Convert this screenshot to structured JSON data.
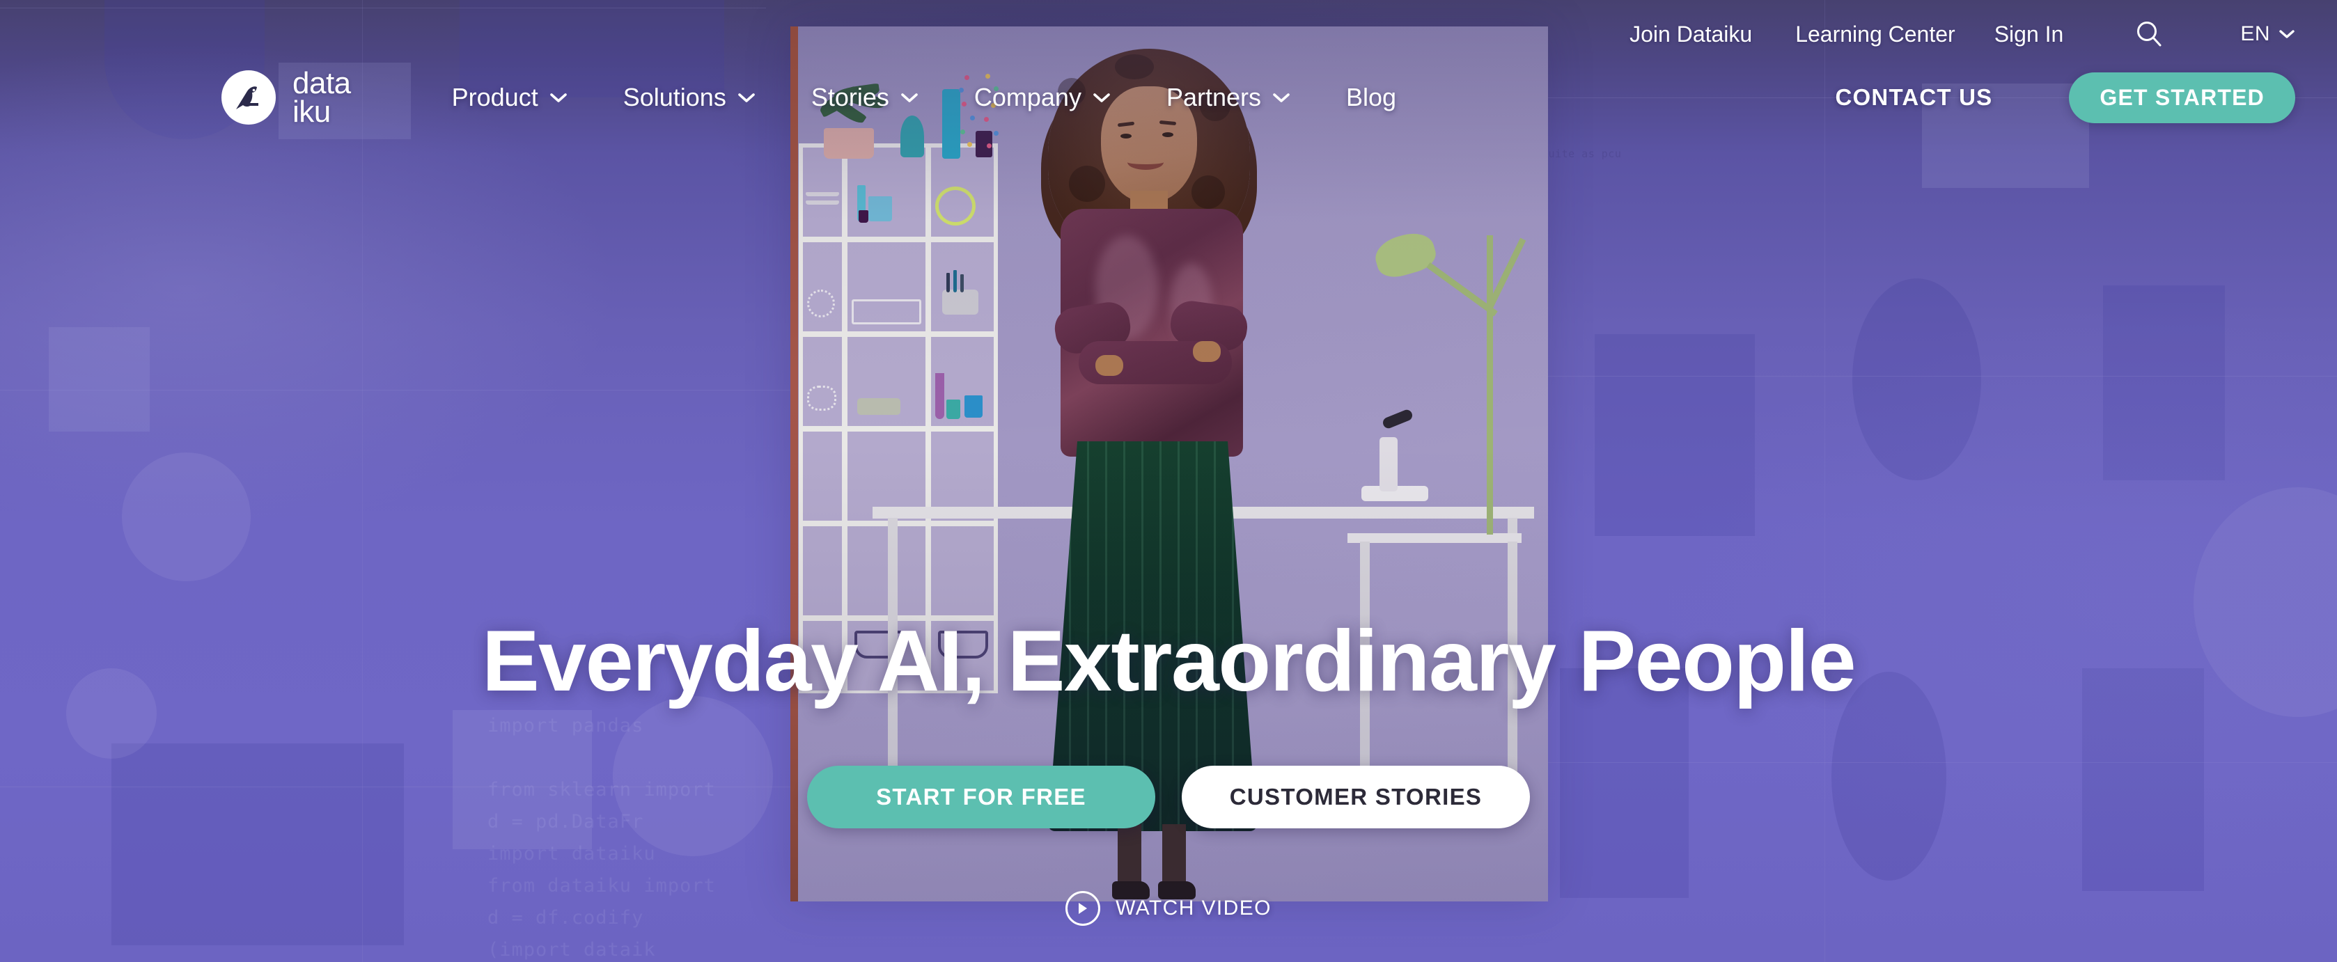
{
  "brand": {
    "logo_icon": "dataiku-bird-logo-icon",
    "name_line1": "data",
    "name_line2": "iku"
  },
  "utility_nav": {
    "items": [
      {
        "label": "Join Dataiku",
        "name": "join-dataiku"
      },
      {
        "label": "Learning Center",
        "name": "learning-center"
      },
      {
        "label": "Sign In",
        "name": "sign-in"
      }
    ],
    "search_icon": "search-icon",
    "language": {
      "value": "EN",
      "chevron_icon": "chevron-down-icon"
    }
  },
  "main_nav": {
    "items": [
      {
        "label": "Product",
        "has_dropdown": true
      },
      {
        "label": "Solutions",
        "has_dropdown": true
      },
      {
        "label": "Stories",
        "has_dropdown": true
      },
      {
        "label": "Company",
        "has_dropdown": true
      },
      {
        "label": "Partners",
        "has_dropdown": true
      },
      {
        "label": "Blog",
        "has_dropdown": false
      }
    ],
    "contact_label": "CONTACT US",
    "get_started_label": "GET STARTED"
  },
  "hero": {
    "headline": "Everyday AI, Extraordinary People",
    "primary_cta": "START FOR FREE",
    "secondary_cta": "CUSTOMER STORIES",
    "watch_video_label": "WATCH VIDEO",
    "play_icon": "play-circle-icon"
  },
  "background": {
    "code_snippet_left": "import pandas\n\nfrom sklearn import\nd = pd.DataFr\nimport dataiku\nfrom dataiku import\nd = df.codify\n(import dataik",
    "code_snippet_right": "suite as pcu"
  },
  "colors": {
    "accent_teal": "#5CBFB0",
    "hero_purple": "#6A62C0",
    "nav_purple_dark": "#474170",
    "white": "#FFFFFF",
    "text_dark": "#2C2A38"
  }
}
